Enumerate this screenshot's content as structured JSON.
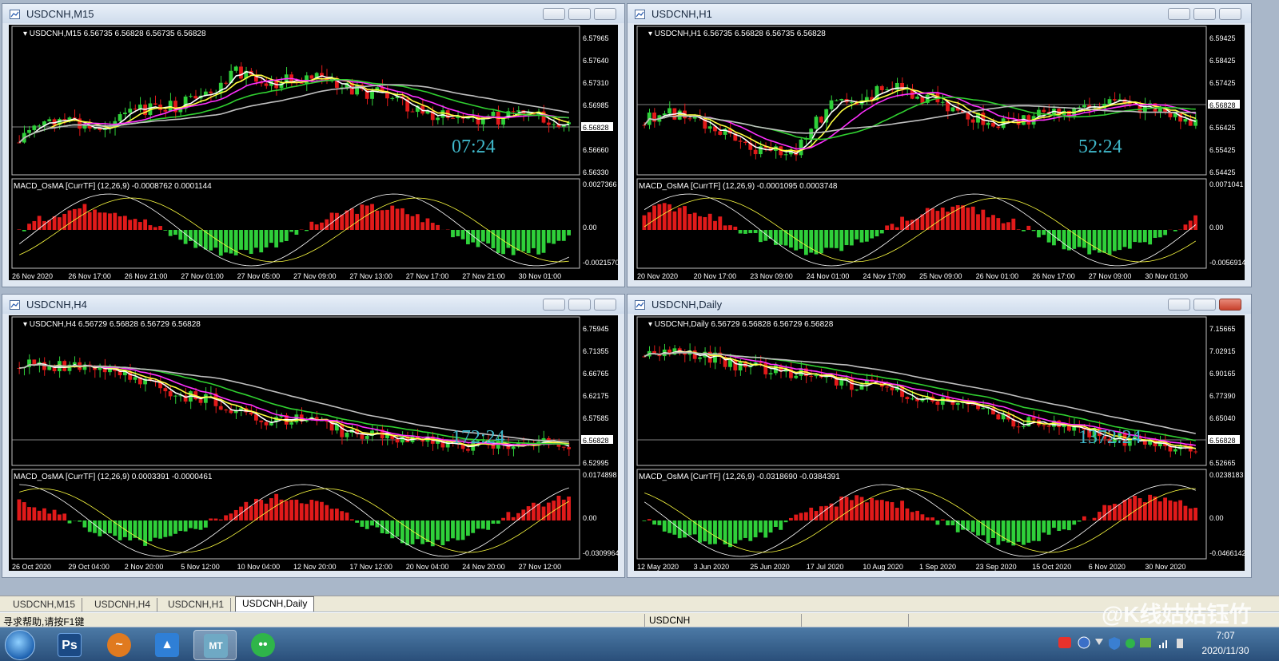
{
  "windows": [
    {
      "title": "USDCNH,M15",
      "info": "USDCNH,M15  6.56735 6.56828 6.56735 6.56828",
      "price_labels": [
        "6.57965",
        "6.57640",
        "6.57310",
        "6.56985",
        "6.56828",
        "6.56660",
        "6.56330"
      ],
      "current_price": "6.56828",
      "timer": "07:24",
      "macd_label": "MACD_OsMA [CurrTF] (12,26,9) -0.0008762 0.0001144",
      "macd_levels": [
        "0.0027366",
        "0.00",
        "-0.0021570"
      ],
      "time_labels": [
        "26 Nov 2020",
        "26 Nov 17:00",
        "26 Nov 21:00",
        "27 Nov 01:00",
        "27 Nov 05:00",
        "27 Nov 09:00",
        "27 Nov 13:00",
        "27 Nov 17:00",
        "27 Nov 21:00",
        "30 Nov 01:00"
      ]
    },
    {
      "title": "USDCNH,H1",
      "info": "USDCNH,H1  6.56735 6.56828 6.56735 6.56828",
      "price_labels": [
        "6.59425",
        "6.58425",
        "6.57425",
        "6.56828",
        "6.56425",
        "6.55425",
        "6.54425"
      ],
      "current_price": "6.56828",
      "timer": "52:24",
      "macd_label": "MACD_OsMA [CurrTF] (12,26,9) -0.0001095 0.0003748",
      "macd_levels": [
        "0.0071041",
        "0.00",
        "-0.0056914"
      ],
      "time_labels": [
        "20 Nov 2020",
        "20 Nov 17:00",
        "23 Nov 09:00",
        "24 Nov 01:00",
        "24 Nov 17:00",
        "25 Nov 09:00",
        "26 Nov 01:00",
        "26 Nov 17:00",
        "27 Nov 09:00",
        "30 Nov 01:00"
      ]
    },
    {
      "title": "USDCNH,H4",
      "info": "USDCNH,H4  6.56729 6.56828 6.56729 6.56828",
      "price_labels": [
        "6.75945",
        "6.71355",
        "6.66765",
        "6.62175",
        "6.57585",
        "6.56828",
        "6.52995"
      ],
      "current_price": "6.56828",
      "timer": "172:24",
      "macd_label": "MACD_OsMA [CurrTF] (12,26,9) 0.0003391 -0.0000461",
      "macd_levels": [
        "0.0174898",
        "0.00",
        "-0.0309964"
      ],
      "time_labels": [
        "26 Oct 2020",
        "29 Oct 04:00",
        "2 Nov 20:00",
        "5 Nov 12:00",
        "10 Nov 04:00",
        "12 Nov 20:00",
        "17 Nov 12:00",
        "20 Nov 04:00",
        "24 Nov 20:00",
        "27 Nov 12:00"
      ]
    },
    {
      "title": "USDCNH,Daily",
      "info": "USDCNH,Daily  6.56729 6.56828 6.56729 6.56828",
      "price_labels": [
        "7.15665",
        "7.02915",
        "6.90165",
        "6.77390",
        "6.65040",
        "6.56828",
        "6.52665"
      ],
      "current_price": "6.56828",
      "timer": "1372:24",
      "macd_label": "MACD_OsMA [CurrTF] (12,26,9) -0.0318690 -0.0384391",
      "macd_levels": [
        "0.0238183",
        "0.00",
        "-0.0466142"
      ],
      "time_labels": [
        "12 May 2020",
        "3 Jun 2020",
        "25 Jun 2020",
        "17 Jul 2020",
        "10 Aug 2020",
        "1 Sep 2020",
        "23 Sep 2020",
        "15 Oct 2020",
        "6 Nov 2020",
        "30 Nov 2020"
      ]
    }
  ],
  "tabs": [
    {
      "label": "USDCNH,M15"
    },
    {
      "label": "USDCNH,H4"
    },
    {
      "label": "USDCNH,H1"
    },
    {
      "label": "USDCNH,Daily"
    }
  ],
  "status": {
    "help": "寻求帮助,请按F1键",
    "symbol": "USDCNH"
  },
  "taskbar": {
    "apps": [
      {
        "icon": "photoshop-icon",
        "glyph": "Ps",
        "color": "#1b4a85"
      },
      {
        "icon": "app-orange-icon",
        "glyph": "~",
        "color": "#e07a1f"
      },
      {
        "icon": "app-blue-icon",
        "glyph": "▲",
        "color": "#2f7fd6"
      },
      {
        "icon": "metatrader-icon",
        "glyph": "MT",
        "color": "#6fa9c4"
      },
      {
        "icon": "wechat-icon",
        "glyph": "••",
        "color": "#2fb54a"
      }
    ],
    "time": "7:07",
    "date": "2020/11/30"
  },
  "watermark": "@K线姑姑钰竹"
}
